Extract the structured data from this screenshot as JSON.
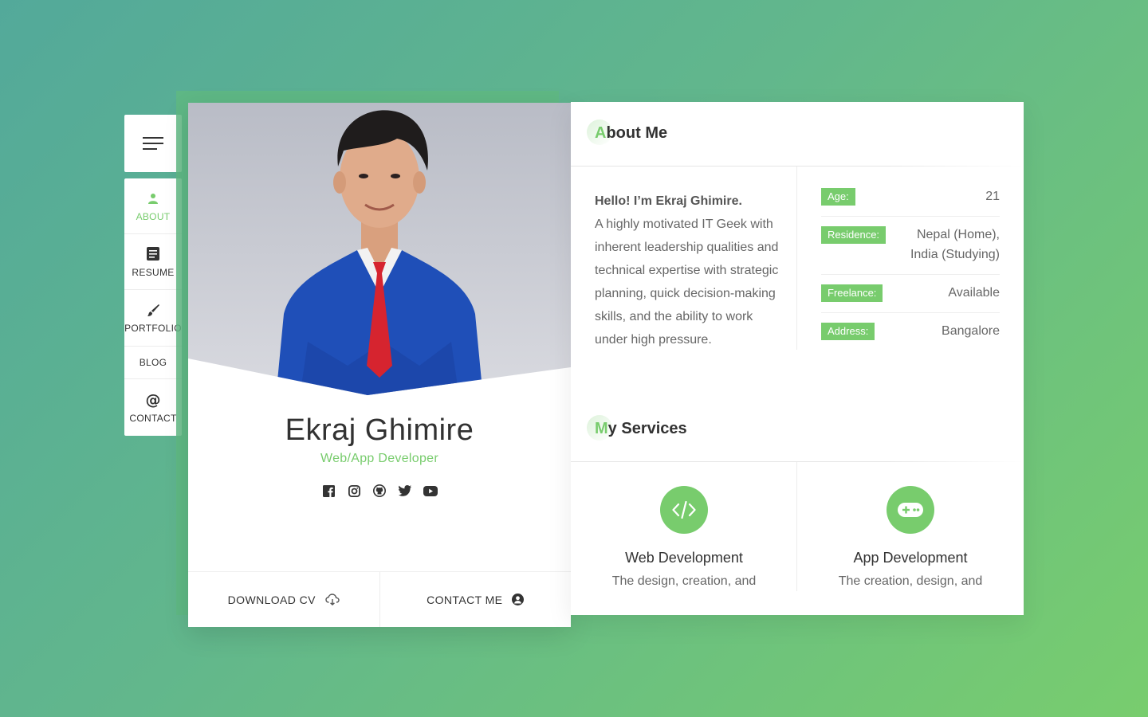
{
  "nav": {
    "items": [
      {
        "label": "ABOUT",
        "icon": "person-icon",
        "active": true
      },
      {
        "label": "RESUME",
        "icon": "document-icon",
        "active": false
      },
      {
        "label": "PORTFOLIO",
        "icon": "brush-icon",
        "active": false
      },
      {
        "label": "BLOG",
        "icon": "",
        "active": false
      },
      {
        "label": "CONTACT",
        "icon": "at-icon",
        "active": false
      }
    ]
  },
  "profile": {
    "name": "Ekraj Ghimire",
    "role": "Web/App Developer",
    "socials": [
      "facebook-icon",
      "instagram-icon",
      "github-icon",
      "twitter-icon",
      "youtube-icon"
    ],
    "download_label": "DOWNLOAD CV",
    "contact_label": "CONTACT ME"
  },
  "about": {
    "title_first": "A",
    "title_rest": "bout Me",
    "hello": "Hello! I’m Ekraj Ghimire.",
    "text": "A highly motivated IT Geek with inherent leadership qualities and technical expertise with strategic planning, quick decision-making skills, and the ability to work under high pressure.",
    "info": [
      {
        "key": "Age:",
        "value": "21"
      },
      {
        "key": "Residence:",
        "value": "Nepal (Home), India (Studying)"
      },
      {
        "key": "Freelance:",
        "value": "Available"
      },
      {
        "key": "Address:",
        "value": "Bangalore"
      }
    ]
  },
  "services": {
    "title_first": "M",
    "title_rest": "y Services",
    "items": [
      {
        "title": "Web Development",
        "desc": "The design, creation, and",
        "icon": "code-icon"
      },
      {
        "title": "App Development",
        "desc": "The creation, design, and",
        "icon": "gamepad-icon"
      }
    ]
  },
  "colors": {
    "accent": "#78cc6d",
    "text": "#323232"
  }
}
